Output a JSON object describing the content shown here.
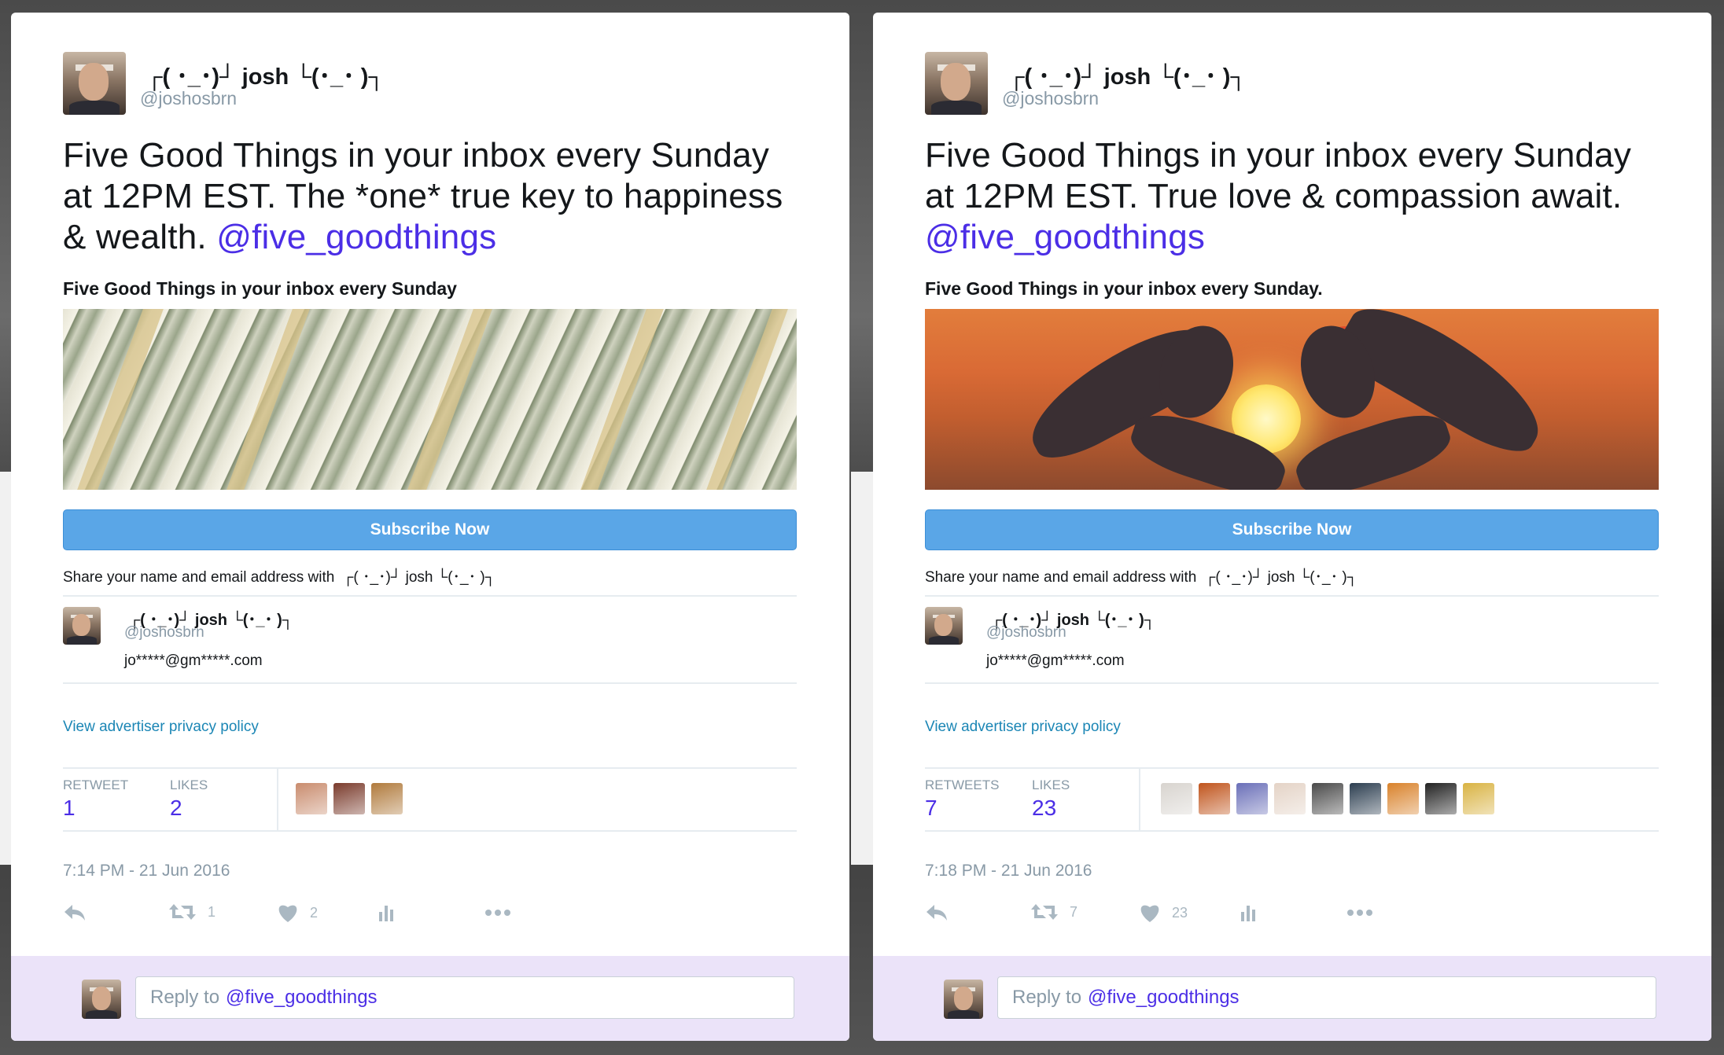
{
  "tweets": [
    {
      "author_name": "┌( ･_･)┘ josh └(･_･ )┐",
      "handle": "@joshosbrn",
      "text": "Five Good Things in your inbox every Sunday at 12PM EST. The *one* true  key to happiness & wealth.",
      "mention": "@five_goodthings",
      "card_title": "Five Good Things in your inbox every Sunday",
      "image": "stacks-of-dollar-bills",
      "subscribe_label": "Subscribe Now",
      "share_text": "Share your name and email address with",
      "share_name": "┌( ･_･)┘ josh └(･_･ )┐",
      "user_name": "┌( ･_･)┘ josh └(･_･ )┐",
      "user_handle": "@joshosbrn",
      "user_email": "jo*****@gm*****.com",
      "privacy_link": "View advertiser privacy policy",
      "retweets_label": "RETWEET",
      "retweets": "1",
      "likes_label": "LIKES",
      "likes": "2",
      "liker_colors": [
        "#c98c6e",
        "#7a3b2c",
        "#b07a3c"
      ],
      "timestamp": "7:14 PM - 21 Jun 2016",
      "action_retweet_count": "1",
      "action_like_count": "2",
      "reply_placeholder": "Reply to",
      "reply_mention": "@five_goodthings"
    },
    {
      "author_name": "┌( ･_･)┘ josh └(･_･ )┐",
      "handle": "@joshosbrn",
      "text": "Five Good Things in your inbox every Sunday at 12PM EST. True love & compassion await.",
      "mention": "@five_goodthings",
      "card_title": "Five Good Things in your inbox every Sunday.",
      "image": "heart-hands-sunset",
      "subscribe_label": "Subscribe Now",
      "share_text": "Share your name and email address with",
      "share_name": "┌( ･_･)┘ josh └(･_･ )┐",
      "user_name": "┌( ･_･)┘ josh └(･_･ )┐",
      "user_handle": "@joshosbrn",
      "user_email": "jo*****@gm*****.com",
      "privacy_link": "View advertiser privacy policy",
      "retweets_label": "RETWEETS",
      "retweets": "7",
      "likes_label": "LIKES",
      "likes": "23",
      "liker_colors": [
        "#d8d4cf",
        "#c0541c",
        "#6a6fb8",
        "#e4d3c6",
        "#4a4a4a",
        "#2c3e50",
        "#d9822b",
        "#222222",
        "#d9b343"
      ],
      "timestamp": "7:18 PM - 21 Jun 2016",
      "action_retweet_count": "7",
      "action_like_count": "23",
      "reply_placeholder": "Reply to",
      "reply_mention": "@five_goodthings"
    }
  ],
  "colors": {
    "mention": "#4b2ee6",
    "subscribe": "#5aa6e7",
    "link": "#1b86b5",
    "reply_bar": "#ebe3f9"
  }
}
